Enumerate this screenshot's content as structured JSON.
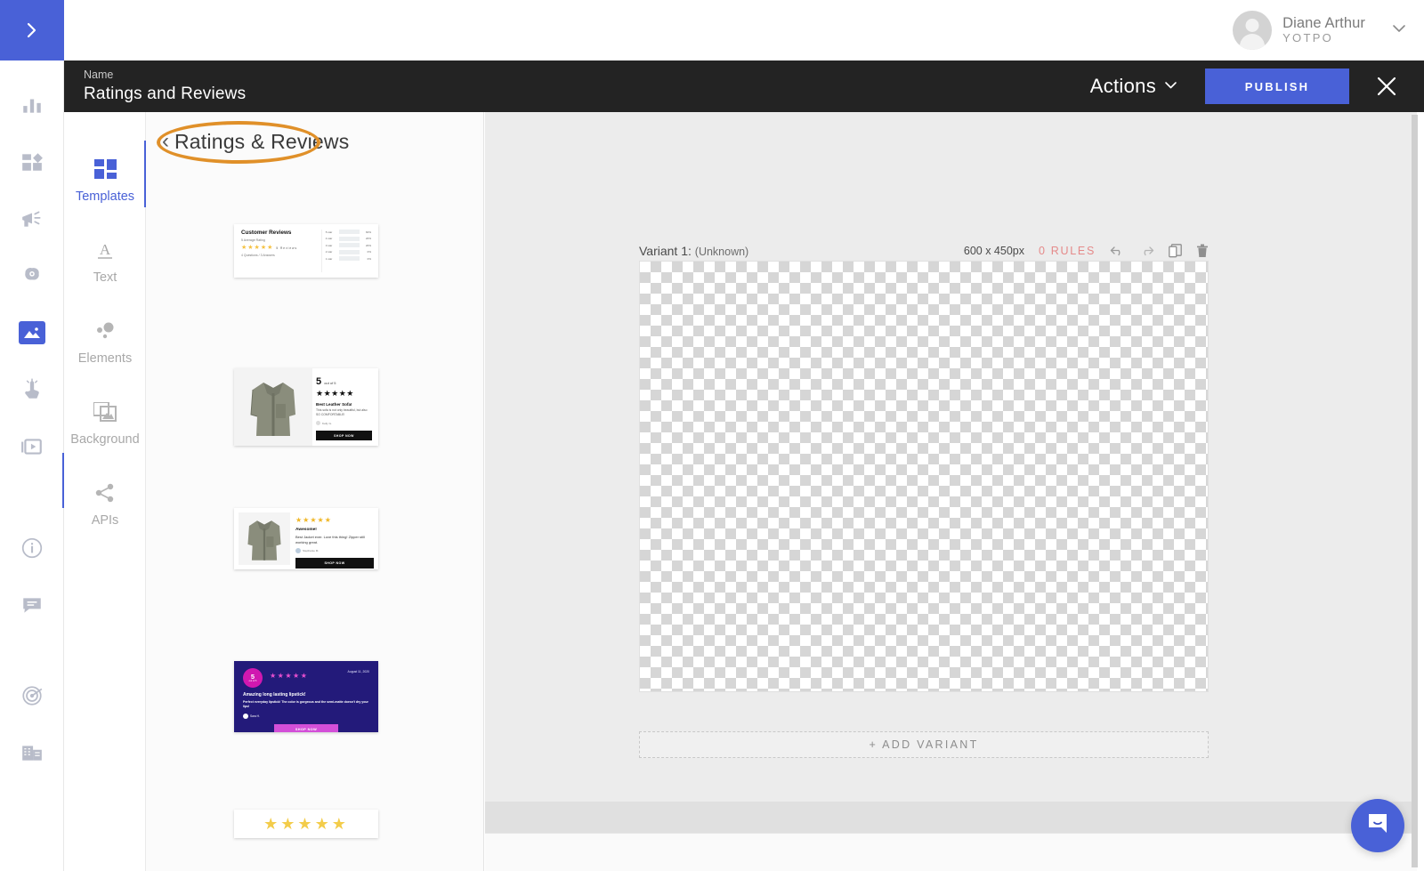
{
  "topbar": {
    "nav_toggle_icon": "chevron-right-icon",
    "user": {
      "name": "Diane Arthur",
      "org": "YOTPO",
      "caret_icon": "chevron-down-icon",
      "avatar_icon": "user-avatar-icon"
    }
  },
  "darkbar": {
    "name_label": "Name",
    "name_value": "Ratings and Reviews",
    "actions_label": "Actions",
    "actions_caret_icon": "chevron-down-icon",
    "publish_label": "PUBLISH",
    "close_icon": "close-icon"
  },
  "rail": {
    "items": [
      {
        "icon": "analytics-bars-icon",
        "active": false
      },
      {
        "icon": "modules-grid-icon",
        "active": false
      },
      {
        "icon": "megaphone-icon",
        "active": false
      },
      {
        "icon": "brain-ai-icon",
        "active": false
      },
      {
        "icon": "image-visual-icon",
        "active": true
      },
      {
        "icon": "tap-touch-icon",
        "active": false
      },
      {
        "icon": "video-player-icon",
        "active": false
      },
      {
        "icon": "info-circle-icon",
        "active": false
      },
      {
        "icon": "chat-message-icon",
        "active": false
      },
      {
        "icon": "target-radar-icon",
        "active": false
      },
      {
        "icon": "building-grid-icon",
        "active": false
      }
    ]
  },
  "tools": [
    {
      "label": "Templates",
      "icon": "templates-grid-icon",
      "active": true
    },
    {
      "label": "Text",
      "icon": "text-a-icon",
      "active": false
    },
    {
      "label": "Elements",
      "icon": "elements-dots-icon",
      "active": false
    },
    {
      "label": "Background",
      "icon": "background-image-icon",
      "active": false
    },
    {
      "label": "APIs",
      "icon": "share-nodes-icon",
      "active": false
    }
  ],
  "templates_panel": {
    "back_icon": "chevron-left-icon",
    "title": "Ratings & Reviews",
    "annotation": {
      "shape": "ellipse",
      "color": "#e09029"
    },
    "cards": [
      {
        "id": "customer-reviews",
        "title": "Customer Reviews",
        "subtitle": "5 Average Rating",
        "stars": "★★★★★",
        "reviews_count": "5 Reviews",
        "qa": "4 Questions / 3 Answers",
        "breakdown": [
          {
            "label": "5 star",
            "pct": "60%"
          },
          {
            "label": "4 star",
            "pct": "20%"
          },
          {
            "label": "3 star",
            "pct": "20%"
          },
          {
            "label": "2 star",
            "pct": "0%"
          },
          {
            "label": "1 star",
            "pct": "0%"
          }
        ]
      },
      {
        "id": "leather-sofa",
        "score": "5",
        "score_suffix": "out of 5",
        "stars": "★★★★★",
        "headline": "Best Leather Sofa!",
        "body": "This sofa is not only beautiful, but also SO COMFORTABLE!",
        "author": "Kelly G.",
        "cta": "SHOP NOW"
      },
      {
        "id": "awesome-jacket",
        "stars": "★★★★★",
        "headline": "Awesome!",
        "body": "Best Jacket ever. Love this thing! Zipper still working great.",
        "author": "Stephanie M.",
        "cta": "SHOP NOW"
      },
      {
        "id": "lipstick-dark",
        "badge_score": "5",
        "badge_suffix": "out of 5",
        "stars": "★★★★★",
        "date": "August 11, 2020",
        "headline": "Amazing long lasting lipstick!",
        "body": "Perfect everyday lipstick! The color is gorgeous and the semi-matte doesn't dry your lips!",
        "author": "Sara H.",
        "cta": "SHOP NOW",
        "bg_color": "#231a7a",
        "accent_color": "#d34fd8"
      },
      {
        "id": "stars-only",
        "stars": "★★★★★"
      }
    ]
  },
  "editor": {
    "variant": {
      "title": "Variant 1:",
      "subtitle": "(Unknown)",
      "size": "600 x 450px",
      "rules": "0 RULES",
      "icons": [
        {
          "name": "undo-icon"
        },
        {
          "name": "redo-icon"
        },
        {
          "name": "duplicate-icon"
        },
        {
          "name": "trash-icon"
        }
      ]
    },
    "add_variant_label": "+  ADD VARIANT"
  },
  "chat": {
    "icon": "chat-bubble-icon",
    "color": "#4961d7"
  }
}
